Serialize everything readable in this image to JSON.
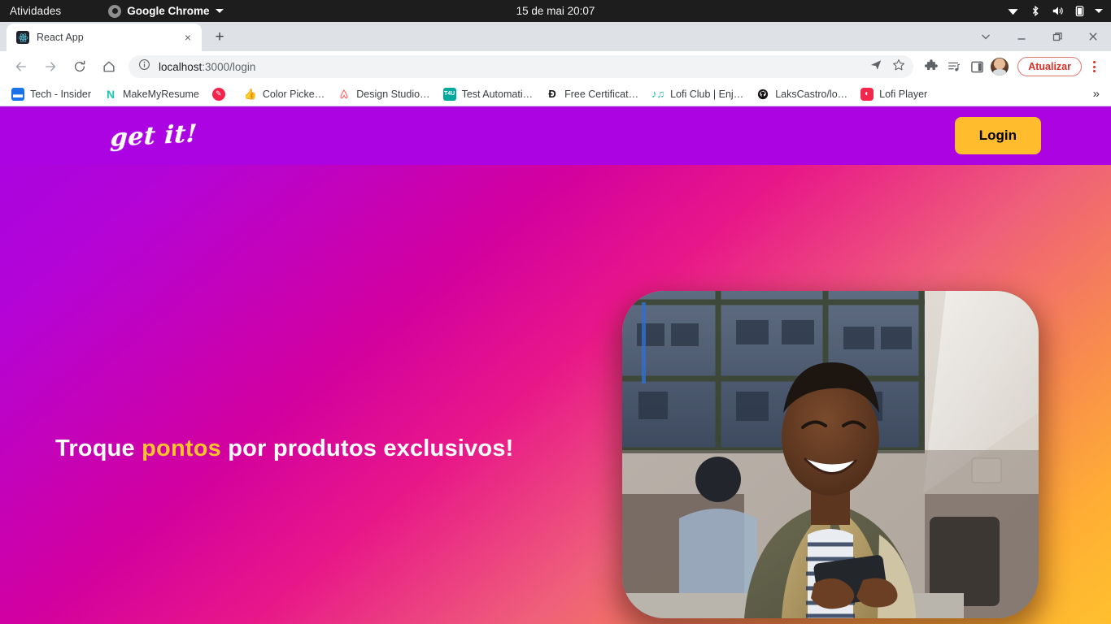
{
  "os_bar": {
    "activities": "Atividades",
    "app_menu": "Google Chrome",
    "clock": "15 de mai  20:07",
    "tray_icons": [
      "wifi-icon",
      "bluetooth-icon",
      "volume-icon",
      "battery-icon",
      "chevron-down-icon"
    ]
  },
  "browser": {
    "tab": {
      "title": "React App",
      "favicon": "react-logo-icon",
      "close": "×"
    },
    "new_tab": "+",
    "window_controls": [
      "tab-search-chevron",
      "minimize",
      "maximize",
      "close"
    ],
    "nav": {
      "back": "back-arrow-icon",
      "forward": "forward-arrow-icon",
      "reload": "reload-icon",
      "home": "home-icon"
    },
    "omnibox": {
      "site_info_icon": "info-circle-icon",
      "url_host": "localhost",
      "url_path": ":3000/login",
      "share_icon": "share-icon",
      "bookmark_icon": "star-icon"
    },
    "toolbar_icons": [
      "extensions-puzzle-icon",
      "reading-list-icon",
      "side-panel-icon"
    ],
    "profile_avatar": "user-avatar",
    "update_button": "Atualizar",
    "menu_icon": "three-dot-menu-icon",
    "bookmarks": [
      {
        "label": "Tech - Insider",
        "icon": "▬",
        "color": "#ffffff",
        "bg": "#1a73e8"
      },
      {
        "label": "MakeMyResume",
        "icon": "N",
        "color": "#19c8b0",
        "bg": "transparent"
      },
      {
        "label": "",
        "icon": "✎",
        "color": "#ffffff",
        "bg": "#f5224a"
      },
      {
        "label": "Color Picke…",
        "icon": "👍",
        "color": "#f2b705",
        "bg": "transparent"
      },
      {
        "label": "Design Studio…",
        "icon": "Ⓐ",
        "color": "#ff5a5f",
        "bg": "transparent"
      },
      {
        "label": "Test Automati…",
        "icon": "T4U",
        "color": "#ffffff",
        "bg": "#00a99d"
      },
      {
        "label": "Free Certificat…",
        "icon": "Đ",
        "color": "#111111",
        "bg": "transparent"
      },
      {
        "label": "Lofi Club | Enj…",
        "icon": "♫",
        "color": "#14b8a6",
        "bg": "transparent"
      },
      {
        "label": "LaksCastro/lo…",
        "icon": "●",
        "color": "#171515",
        "bg": "transparent"
      },
      {
        "label": "Lofi Player",
        "icon": "◐",
        "color": "#ffffff",
        "bg": "#f2274c"
      }
    ],
    "bookmarks_overflow": "»"
  },
  "site": {
    "logo_text": "get it!",
    "login_label": "Login",
    "headline_before": "Troque ",
    "headline_accent": "pontos",
    "headline_after": " por produtos exclusivos!",
    "hero_image_alt": "smiling-man-with-smartphone-photo",
    "colors": {
      "header_purple": "#AC03E3",
      "accent_yellow": "#FFC32E",
      "login_amber": "#FFBD2E",
      "gradient_from": "#A703E0",
      "gradient_mid": "#E81789",
      "gradient_to": "#FFC02E"
    }
  }
}
